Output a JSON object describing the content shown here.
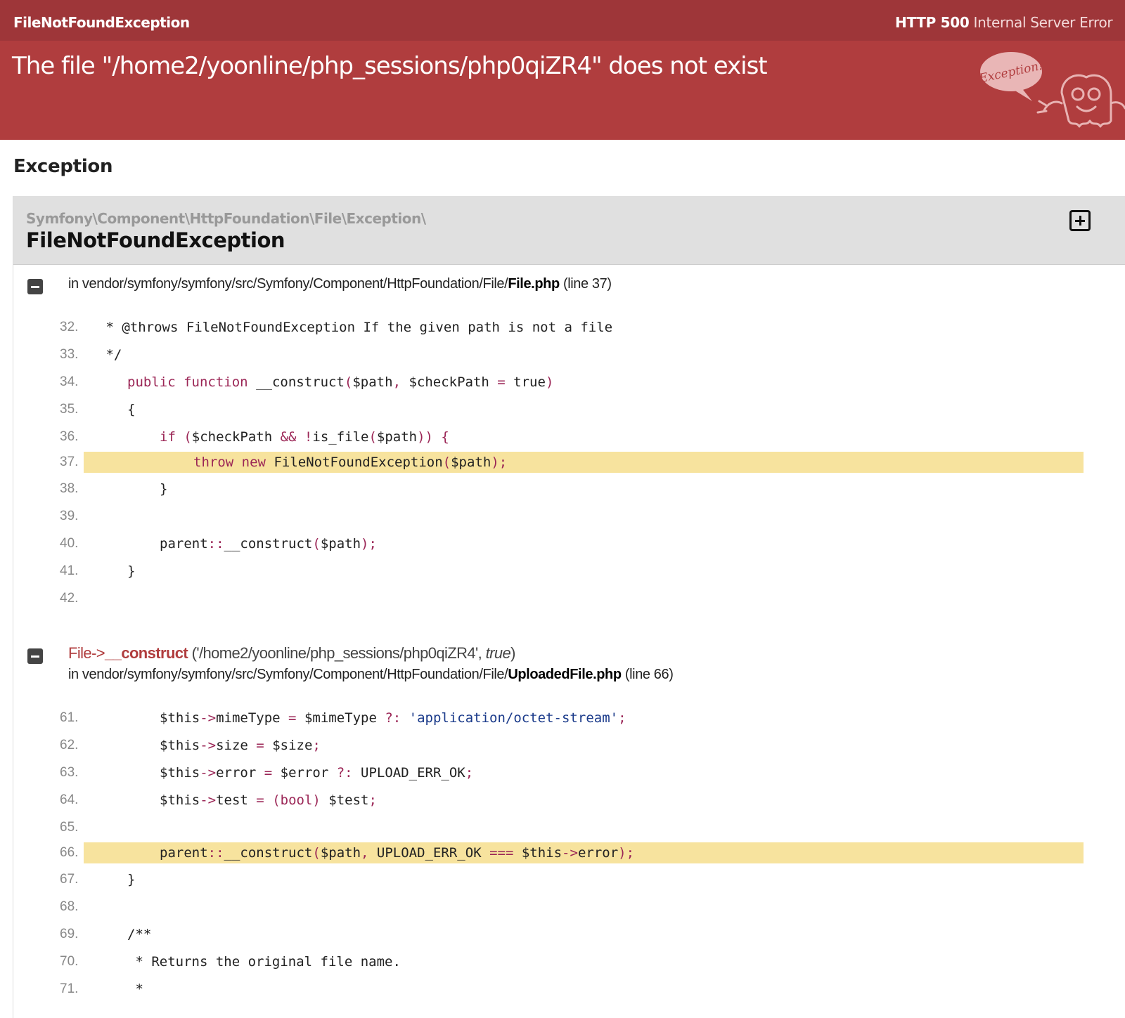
{
  "topbar": {
    "exception_short": "FileNotFoundException",
    "status_code": "HTTP 500",
    "status_text": "Internal Server Error"
  },
  "header": {
    "message": "The file \"/home2/yoonline/php_sessions/php0qiZR4\" does not exist",
    "ghost_bubble": "Exception!"
  },
  "section_title": "Exception",
  "exception": {
    "namespace": "Symfony\\Component\\HttpFoundation\\File\\Exception\\",
    "class": "FileNotFoundException"
  },
  "traces": [
    {
      "prefix": "in vendor/symfony/symfony/src/Symfony/Component/HttpFoundation/File/",
      "file": "File.php",
      "line_info": "(line 37)",
      "lines": [
        {
          "n": "32.",
          "hl": false
        },
        {
          "n": "33.",
          "hl": false
        },
        {
          "n": "34.",
          "hl": false
        },
        {
          "n": "35.",
          "hl": false
        },
        {
          "n": "36.",
          "hl": false
        },
        {
          "n": "37.",
          "hl": true
        },
        {
          "n": "38.",
          "hl": false
        },
        {
          "n": "39.",
          "hl": false
        },
        {
          "n": "40.",
          "hl": false
        },
        {
          "n": "41.",
          "hl": false
        },
        {
          "n": "42.",
          "hl": false
        }
      ]
    },
    {
      "call_class": "File",
      "call_arrow": "->",
      "call_method": "__construct",
      "call_args_open": "('/home2/yoonline/php_sessions/php0qiZR4', ",
      "call_args_italic": "true",
      "call_args_close": ")",
      "prefix": "in vendor/symfony/symfony/src/Symfony/Component/HttpFoundation/File/",
      "file": "UploadedFile.php",
      "line_info": "(line 66)",
      "lines": [
        {
          "n": "61.",
          "hl": false
        },
        {
          "n": "62.",
          "hl": false
        },
        {
          "n": "63.",
          "hl": false
        },
        {
          "n": "64.",
          "hl": false
        },
        {
          "n": "65.",
          "hl": false
        },
        {
          "n": "66.",
          "hl": true
        },
        {
          "n": "67.",
          "hl": false
        },
        {
          "n": "68.",
          "hl": false
        },
        {
          "n": "69.",
          "hl": false
        },
        {
          "n": "70.",
          "hl": false
        },
        {
          "n": "71.",
          "hl": false
        }
      ]
    }
  ],
  "code": {
    "l32": {
      "a": " * @throws FileNotFoundException If the given path is not a file"
    },
    "l33": {
      "a": " */"
    },
    "l34": {
      "kw1": "public",
      "kw2": "function",
      "rest": "__construct",
      "p1": "(",
      "v": "$path",
      "c1": ", ",
      "v2": "$checkPath",
      "eq": " = ",
      "t": "true",
      "p2": ")"
    },
    "l35": {
      "a": "{"
    },
    "l36": {
      "kw": "if",
      "p1": " (",
      "v": "$checkPath",
      "op1": " && !",
      "f": "is_file",
      "p2": "(",
      "v2": "$path",
      "p3": ")) {"
    },
    "l37": {
      "kw1": "throw",
      "kw2": "new",
      "f": "FileNotFoundException",
      "p1": "(",
      "v": "$path",
      "p2": ");"
    },
    "l38": {
      "a": "}"
    },
    "l40": {
      "f": "parent",
      "op": "::",
      "m": "__construct",
      "p1": "(",
      "v": "$path",
      "p2": ");"
    },
    "l41": {
      "a": "}"
    },
    "l61": {
      "v": "$this",
      "op": "->",
      "m": "mimeType",
      "eq": " = ",
      "v2": "$mimeType",
      "op2": " ?: ",
      "s": "'application/octet-stream'",
      "p": ";"
    },
    "l62": {
      "v": "$this",
      "op": "->",
      "m": "size",
      "eq": " = ",
      "v2": "$size",
      "p": ";"
    },
    "l63": {
      "v": "$this",
      "op": "->",
      "m": "error",
      "eq": " = ",
      "v2": "$error",
      "op2": " ?: ",
      "c": "UPLOAD_ERR_OK",
      "p": ";"
    },
    "l64": {
      "v": "$this",
      "op": "->",
      "m": "test",
      "eq": " = ",
      "p1": "(",
      "c": "bool",
      "p2": ")",
      "v2": " $test",
      "p": ";"
    },
    "l66": {
      "f": "parent",
      "op": "::",
      "m": "__construct",
      "p1": "(",
      "v": "$path",
      "c1": ", ",
      "c": "UPLOAD_ERR_OK",
      "op2": " === ",
      "v2": "$this",
      "op3": "->",
      "m2": "error",
      "p2": ");"
    },
    "l67": {
      "a": "}"
    },
    "l69": {
      "a": "/**"
    },
    "l70": {
      "a": " * Returns the original file name."
    },
    "l71": {
      "a": " *"
    }
  },
  "colors": {
    "topbar": "#9e3639",
    "header": "#b03d3e",
    "highlight": "#f7e39e",
    "keyword": "#9b2656",
    "string": "#1a3a8a"
  },
  "icons": {
    "expand": "plus-square-icon",
    "toggle": "minus-square-icon",
    "mascot": "ghost-icon"
  }
}
